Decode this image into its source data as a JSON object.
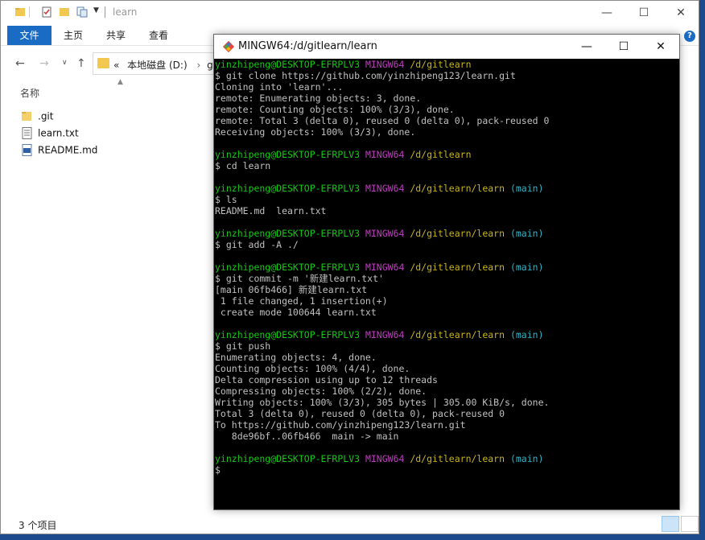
{
  "explorer": {
    "title": "learn",
    "ribbon_tabs": [
      "文件",
      "主页",
      "共享",
      "查看"
    ],
    "address": {
      "drive": "本地磁盘 (D:)",
      "folder_prefix": "git",
      "sep": "«"
    },
    "column_header": "名称",
    "files": [
      {
        "name": ".git",
        "icon": "folder-icon"
      },
      {
        "name": "learn.txt",
        "icon": "text-file-icon"
      },
      {
        "name": "README.md",
        "icon": "markdown-file-icon"
      }
    ],
    "status": "3 个项目"
  },
  "terminal": {
    "title": "MINGW64:/d/gitlearn/learn",
    "lines": [
      [
        [
          "user",
          "yinzhipeng@DESKTOP-EFRPLV3 "
        ],
        [
          "sys",
          "MINGW64 "
        ],
        [
          "path",
          "/d/gitlearn"
        ]
      ],
      [
        [
          "plain",
          "$ git clone https://github.com/yinzhipeng123/learn.git"
        ]
      ],
      [
        [
          "plain",
          "Cloning into 'learn'..."
        ]
      ],
      [
        [
          "plain",
          "remote: Enumerating objects: 3, done."
        ]
      ],
      [
        [
          "plain",
          "remote: Counting objects: 100% (3/3), done."
        ]
      ],
      [
        [
          "plain",
          "remote: Total 3 (delta 0), reused 0 (delta 0), pack-reused 0"
        ]
      ],
      [
        [
          "plain",
          "Receiving objects: 100% (3/3), done."
        ]
      ],
      [
        [
          "plain",
          ""
        ]
      ],
      [
        [
          "user",
          "yinzhipeng@DESKTOP-EFRPLV3 "
        ],
        [
          "sys",
          "MINGW64 "
        ],
        [
          "path",
          "/d/gitlearn"
        ]
      ],
      [
        [
          "plain",
          "$ cd learn"
        ]
      ],
      [
        [
          "plain",
          ""
        ]
      ],
      [
        [
          "user",
          "yinzhipeng@DESKTOP-EFRPLV3 "
        ],
        [
          "sys",
          "MINGW64 "
        ],
        [
          "path",
          "/d/gitlearn/learn "
        ],
        [
          "branch",
          "(main)"
        ]
      ],
      [
        [
          "plain",
          "$ ls"
        ]
      ],
      [
        [
          "plain",
          "README.md  learn.txt"
        ]
      ],
      [
        [
          "plain",
          ""
        ]
      ],
      [
        [
          "user",
          "yinzhipeng@DESKTOP-EFRPLV3 "
        ],
        [
          "sys",
          "MINGW64 "
        ],
        [
          "path",
          "/d/gitlearn/learn "
        ],
        [
          "branch",
          "(main)"
        ]
      ],
      [
        [
          "plain",
          "$ git add -A ./"
        ]
      ],
      [
        [
          "plain",
          ""
        ]
      ],
      [
        [
          "user",
          "yinzhipeng@DESKTOP-EFRPLV3 "
        ],
        [
          "sys",
          "MINGW64 "
        ],
        [
          "path",
          "/d/gitlearn/learn "
        ],
        [
          "branch",
          "(main)"
        ]
      ],
      [
        [
          "plain",
          "$ git commit -m '新建learn.txt'"
        ]
      ],
      [
        [
          "plain",
          "[main 06fb466] 新建learn.txt"
        ]
      ],
      [
        [
          "plain",
          " 1 file changed, 1 insertion(+)"
        ]
      ],
      [
        [
          "plain",
          " create mode 100644 learn.txt"
        ]
      ],
      [
        [
          "plain",
          ""
        ]
      ],
      [
        [
          "user",
          "yinzhipeng@DESKTOP-EFRPLV3 "
        ],
        [
          "sys",
          "MINGW64 "
        ],
        [
          "path",
          "/d/gitlearn/learn "
        ],
        [
          "branch",
          "(main)"
        ]
      ],
      [
        [
          "plain",
          "$ git push"
        ]
      ],
      [
        [
          "plain",
          "Enumerating objects: 4, done."
        ]
      ],
      [
        [
          "plain",
          "Counting objects: 100% (4/4), done."
        ]
      ],
      [
        [
          "plain",
          "Delta compression using up to 12 threads"
        ]
      ],
      [
        [
          "plain",
          "Compressing objects: 100% (2/2), done."
        ]
      ],
      [
        [
          "plain",
          "Writing objects: 100% (3/3), 305 bytes | 305.00 KiB/s, done."
        ]
      ],
      [
        [
          "plain",
          "Total 3 (delta 0), reused 0 (delta 0), pack-reused 0"
        ]
      ],
      [
        [
          "plain",
          "To https://github.com/yinzhipeng123/learn.git"
        ]
      ],
      [
        [
          "plain",
          "   8de96bf..06fb466  main -> main"
        ]
      ],
      [
        [
          "plain",
          ""
        ]
      ],
      [
        [
          "user",
          "yinzhipeng@DESKTOP-EFRPLV3 "
        ],
        [
          "sys",
          "MINGW64 "
        ],
        [
          "path",
          "/d/gitlearn/learn "
        ],
        [
          "branch",
          "(main)"
        ]
      ],
      [
        [
          "plain",
          "$"
        ]
      ]
    ]
  }
}
